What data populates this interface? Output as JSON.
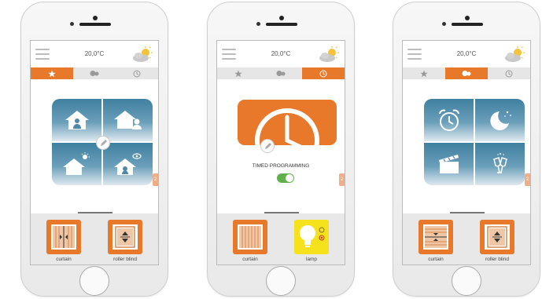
{
  "phones": [
    {
      "temperature": "20,0°C",
      "tabs": [
        "favorites",
        "scenes",
        "timer"
      ],
      "active_tab": "favorites",
      "content": "house-modes",
      "side_tab_label": "2",
      "devices": [
        {
          "label": "curtain",
          "icon": "curtain-icon"
        },
        {
          "label": "roller blind",
          "icon": "roller-blind-icon"
        }
      ]
    },
    {
      "temperature": "20,0°C",
      "tabs": [
        "favorites",
        "scenes",
        "timer"
      ],
      "active_tab": "timer",
      "content": "timed-programming",
      "timed_programming_label": "TIMED PROGRAMMING",
      "toggle_on": true,
      "side_tab_label": "2",
      "devices": [
        {
          "label": "curtain",
          "icon": "curtain-icon"
        },
        {
          "label": "lamp",
          "icon": "lamp-icon"
        }
      ]
    },
    {
      "temperature": "20,0°C",
      "tabs": [
        "favorites",
        "scenes",
        "timer"
      ],
      "active_tab": "scenes",
      "content": "scene-modes",
      "side_tab_label": "2",
      "devices": [
        {
          "label": "curtain",
          "icon": "curtain-icon"
        },
        {
          "label": "roller blind",
          "icon": "roller-blind-icon"
        }
      ]
    }
  ],
  "colors": {
    "accent": "#e8782a",
    "tile_blue": "#3f7f9f",
    "toggle_green": "#62b04b",
    "lamp_yellow": "#f5e21c"
  }
}
